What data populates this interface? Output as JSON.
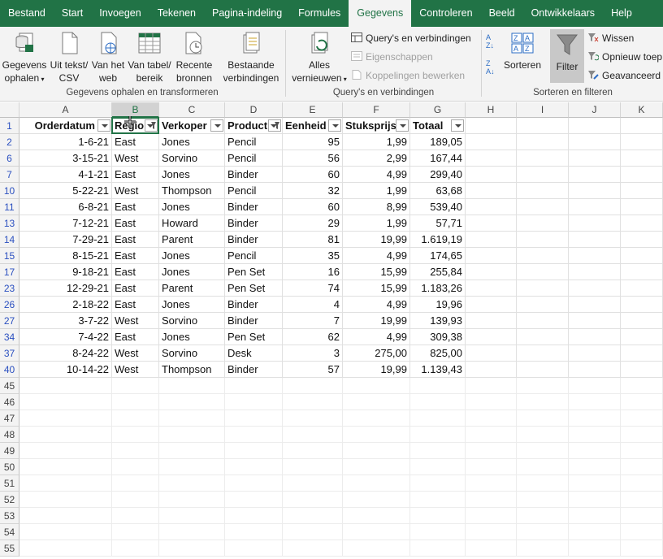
{
  "tabs": [
    "Bestand",
    "Start",
    "Invoegen",
    "Tekenen",
    "Pagina-indeling",
    "Formules",
    "Gegevens",
    "Controleren",
    "Beeld",
    "Ontwikkelaars",
    "Help"
  ],
  "active_tab": "Gegevens",
  "ribbon": {
    "get_data": {
      "line1": "Gegevens",
      "line2": "ophalen"
    },
    "from_text": {
      "line1": "Uit tekst/",
      "line2": "CSV"
    },
    "from_web": {
      "line1": "Van het",
      "line2": "web"
    },
    "from_table": {
      "line1": "Van tabel/",
      "line2": "bereik"
    },
    "recent": {
      "line1": "Recente",
      "line2": "bronnen"
    },
    "existing": {
      "line1": "Bestaande",
      "line2": "verbindingen"
    },
    "group1": "Gegevens ophalen en transformeren",
    "refresh": {
      "line1": "Alles",
      "line2": "vernieuwen"
    },
    "queries": "Query's en verbindingen",
    "properties": "Eigenschappen",
    "edit_links": "Koppelingen bewerken",
    "group2": "Query's en verbindingen",
    "sort": "Sorteren",
    "filter": "Filter",
    "clear": "Wissen",
    "reapply": "Opnieuw toep",
    "advanced": "Geavanceerd",
    "group3": "Sorteren en filteren"
  },
  "columns": [
    "A",
    "B",
    "C",
    "D",
    "E",
    "F",
    "G",
    "H",
    "I",
    "J",
    "K"
  ],
  "headers": [
    "Orderdatum",
    "Regio",
    "Verkoper",
    "Product",
    "Eenheid",
    "Stuksprijs",
    "Totaal"
  ],
  "rows": [
    {
      "n": "2",
      "v": [
        "1-6-21",
        "East",
        "Jones",
        "Pencil",
        "95",
        "1,99",
        "189,05"
      ]
    },
    {
      "n": "6",
      "v": [
        "3-15-21",
        "West",
        "Sorvino",
        "Pencil",
        "56",
        "2,99",
        "167,44"
      ]
    },
    {
      "n": "7",
      "v": [
        "4-1-21",
        "East",
        "Jones",
        "Binder",
        "60",
        "4,99",
        "299,40"
      ]
    },
    {
      "n": "10",
      "v": [
        "5-22-21",
        "West",
        "Thompson",
        "Pencil",
        "32",
        "1,99",
        "63,68"
      ]
    },
    {
      "n": "11",
      "v": [
        "6-8-21",
        "East",
        "Jones",
        "Binder",
        "60",
        "8,99",
        "539,40"
      ]
    },
    {
      "n": "13",
      "v": [
        "7-12-21",
        "East",
        "Howard",
        "Binder",
        "29",
        "1,99",
        "57,71"
      ]
    },
    {
      "n": "14",
      "v": [
        "7-29-21",
        "East",
        "Parent",
        "Binder",
        "81",
        "19,99",
        "1.619,19"
      ]
    },
    {
      "n": "15",
      "v": [
        "8-15-21",
        "East",
        "Jones",
        "Pencil",
        "35",
        "4,99",
        "174,65"
      ]
    },
    {
      "n": "17",
      "v": [
        "9-18-21",
        "East",
        "Jones",
        "Pen Set",
        "16",
        "15,99",
        "255,84"
      ]
    },
    {
      "n": "23",
      "v": [
        "12-29-21",
        "East",
        "Parent",
        "Pen Set",
        "74",
        "15,99",
        "1.183,26"
      ]
    },
    {
      "n": "26",
      "v": [
        "2-18-22",
        "East",
        "Jones",
        "Binder",
        "4",
        "4,99",
        "19,96"
      ]
    },
    {
      "n": "27",
      "v": [
        "3-7-22",
        "West",
        "Sorvino",
        "Binder",
        "7",
        "19,99",
        "139,93"
      ]
    },
    {
      "n": "34",
      "v": [
        "7-4-22",
        "East",
        "Jones",
        "Pen Set",
        "62",
        "4,99",
        "309,38"
      ]
    },
    {
      "n": "37",
      "v": [
        "8-24-22",
        "West",
        "Sorvino",
        "Desk",
        "3",
        "275,00",
        "825,00"
      ]
    },
    {
      "n": "40",
      "v": [
        "10-14-22",
        "West",
        "Thompson",
        "Binder",
        "57",
        "19,99",
        "1.139,43"
      ]
    }
  ],
  "header_row": "1",
  "empty_rows": [
    "45",
    "46",
    "47",
    "48",
    "49",
    "50",
    "51",
    "52",
    "53",
    "54",
    "55"
  ],
  "colors": {
    "accent": "#217346",
    "row_number": "#2b50c0"
  }
}
